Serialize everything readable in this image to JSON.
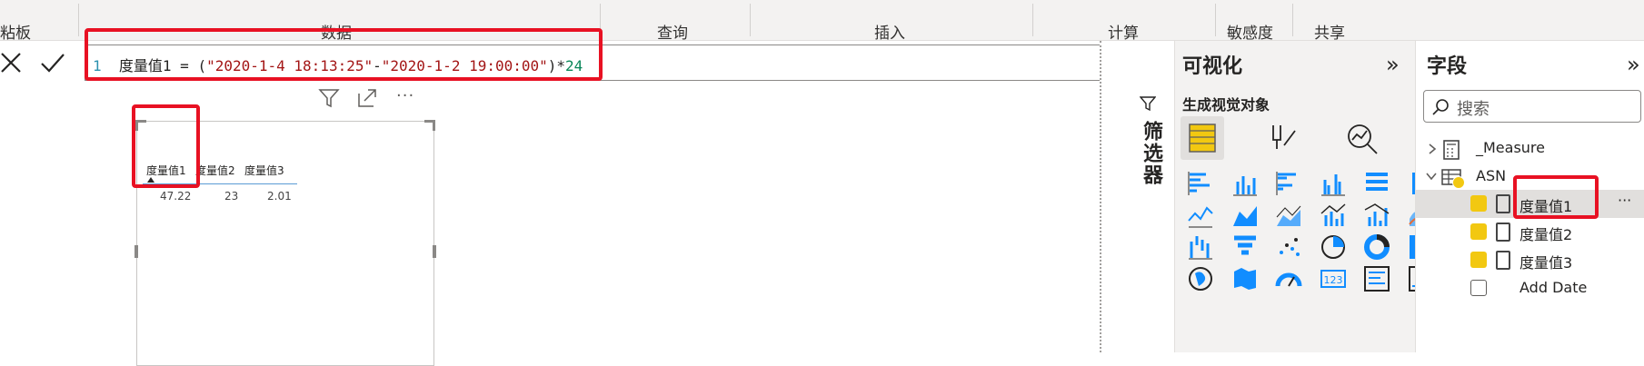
{
  "ribbon": {
    "groups": [
      "粘板",
      "数据",
      "查询",
      "插入",
      "计算",
      "敏感度",
      "共享"
    ]
  },
  "formula": {
    "line_number": "1",
    "text_prefix": "度量值1 = (",
    "str1": "\"2020-1-4 18:13:25\"",
    "minus": "-",
    "str2": "\"2020-1-2 19:00:00\"",
    "close": ")*",
    "num": "24"
  },
  "table": {
    "headers": [
      "度量值1",
      "度量值2",
      "度量值3"
    ],
    "values": [
      "47.22",
      "23",
      "2.01"
    ]
  },
  "filters": {
    "label": "筛选器"
  },
  "viz": {
    "title": "可视化",
    "build_label": "生成视觉对象"
  },
  "fields": {
    "title": "字段",
    "search_placeholder": "搜索",
    "tables": [
      {
        "name": "_Measure",
        "expanded": false
      },
      {
        "name": "ASN",
        "expanded": true
      }
    ],
    "items": [
      {
        "label": "度量值1",
        "checked": true
      },
      {
        "label": "度量值2",
        "checked": true
      },
      {
        "label": "度量值3",
        "checked": true
      },
      {
        "label": "Add Date",
        "checked": false
      }
    ]
  },
  "colors": {
    "accent_yellow": "#f2c811",
    "highlight_red": "#e81123",
    "string": "#a31515",
    "number": "#098658"
  }
}
